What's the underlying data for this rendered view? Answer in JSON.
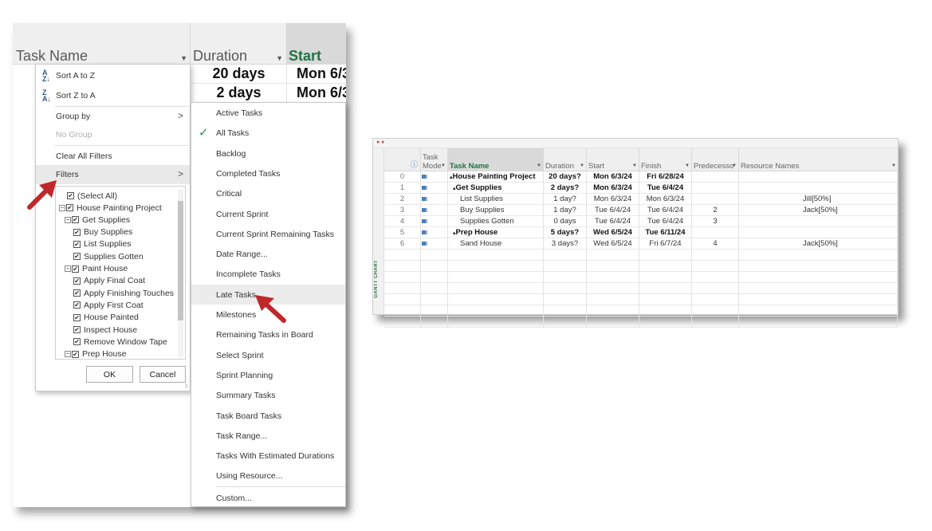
{
  "left_header": {
    "task_name": "Task Name",
    "duration": "Duration",
    "start": "Start",
    "rows": [
      {
        "duration": "20 days",
        "start": "Mon 6/3"
      },
      {
        "duration": "2 days",
        "start": "Mon 6/3"
      }
    ]
  },
  "sort_menu": {
    "sort_a_z": "Sort A to Z",
    "sort_z_a": "Sort Z to A",
    "group_by": "Group by",
    "no_group": "No Group",
    "clear_all_filters": "Clear All Filters",
    "filters": "Filters",
    "select_all": "(Select All)",
    "tree": [
      {
        "label": "House Painting Project",
        "level": 0,
        "expand": true
      },
      {
        "label": "Get Supplies",
        "level": 1,
        "expand": true
      },
      {
        "label": "Buy Supplies",
        "level": 2,
        "expand": false
      },
      {
        "label": "List Supplies",
        "level": 2,
        "expand": false
      },
      {
        "label": "Supplies Gotten",
        "level": 2,
        "expand": false
      },
      {
        "label": "Paint House",
        "level": 1,
        "expand": true
      },
      {
        "label": "Apply Final Coat",
        "level": 2,
        "expand": false
      },
      {
        "label": "Apply Finishing Touches",
        "level": 2,
        "expand": false
      },
      {
        "label": "Apply First Coat",
        "level": 2,
        "expand": false
      },
      {
        "label": "House Painted",
        "level": 2,
        "expand": false
      },
      {
        "label": "Inspect House",
        "level": 2,
        "expand": false
      },
      {
        "label": "Remove Window Tape",
        "level": 2,
        "expand": false
      },
      {
        "label": "Prep House",
        "level": 1,
        "expand": true
      }
    ],
    "ok": "OK",
    "cancel": "Cancel"
  },
  "filters_menu": {
    "items": [
      "Active Tasks",
      "All Tasks",
      "Backlog",
      "Completed Tasks",
      "Critical",
      "Current Sprint",
      "Current Sprint Remaining Tasks",
      "Date Range...",
      "Incomplete Tasks",
      "Late Tasks",
      "Milestones",
      "Remaining Tasks in Board",
      "Select Sprint",
      "Sprint Planning",
      "Summary Tasks",
      "Task Board Tasks",
      "Task Range...",
      "Tasks With Estimated Durations",
      "Using Resource..."
    ],
    "checked": "All Tasks",
    "highlighted": "Late Tasks",
    "custom": "Custom..."
  },
  "gantt": {
    "side_label": "GANTT CHART",
    "headers": {
      "task_mode_line1": "Task",
      "task_mode_line2": "Mode",
      "task_name": "Task Name",
      "duration": "Duration",
      "start": "Start",
      "finish": "Finish",
      "predecessors": "Predecesso",
      "resource_names": "Resource Names"
    },
    "rows": [
      {
        "id": "0",
        "name": "House Painting Project",
        "duration": "20 days?",
        "start": "Mon 6/3/24",
        "finish": "Fri 6/28/24",
        "pred": "",
        "res": "",
        "bold": true,
        "indent": 0,
        "collapse": true
      },
      {
        "id": "1",
        "name": "Get Supplies",
        "duration": "2 days?",
        "start": "Mon 6/3/24",
        "finish": "Tue 6/4/24",
        "pred": "",
        "res": "",
        "bold": true,
        "indent": 1,
        "collapse": true
      },
      {
        "id": "2",
        "name": "List Supplies",
        "duration": "1 day?",
        "start": "Mon 6/3/24",
        "finish": "Mon 6/3/24",
        "pred": "",
        "res": "Jill[50%]",
        "bold": false,
        "indent": 2,
        "collapse": false
      },
      {
        "id": "3",
        "name": "Buy Supplies",
        "duration": "1 day?",
        "start": "Tue 6/4/24",
        "finish": "Tue 6/4/24",
        "pred": "2",
        "res": "Jack[50%]",
        "bold": false,
        "indent": 2,
        "collapse": false
      },
      {
        "id": "4",
        "name": "Supplies Gotten",
        "duration": "0 days",
        "start": "Tue 6/4/24",
        "finish": "Tue 6/4/24",
        "pred": "3",
        "res": "",
        "bold": false,
        "indent": 2,
        "collapse": false
      },
      {
        "id": "5",
        "name": "Prep House",
        "duration": "5 days?",
        "start": "Wed 6/5/24",
        "finish": "Tue 6/11/24",
        "pred": "",
        "res": "",
        "bold": true,
        "indent": 1,
        "collapse": true
      },
      {
        "id": "6",
        "name": "Sand House",
        "duration": "3 days?",
        "start": "Wed 6/5/24",
        "finish": "Fri 6/7/24",
        "pred": "4",
        "res": "Jack[50%]",
        "bold": false,
        "indent": 2,
        "collapse": false
      }
    ],
    "blank_rows": 7
  },
  "colors": {
    "accent_green": "#217346",
    "arrow_red": "#c0282d",
    "check_green": "#2a8a4a"
  }
}
